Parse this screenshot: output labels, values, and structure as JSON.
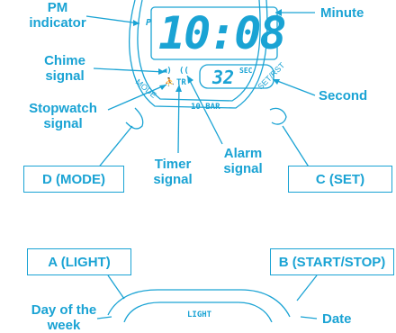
{
  "labels": {
    "pm_indicator": "PM\nindicator",
    "minute": "Minute",
    "chime_signal": "Chime\nsignal",
    "second": "Second",
    "stopwatch_signal": "Stopwatch\nsignal",
    "timer_signal": "Timer\nsignal",
    "alarm_signal": "Alarm\nsignal",
    "day_of_the_week": "Day of the\nweek",
    "date": "Date"
  },
  "buttons": {
    "d_mode": "D (MODE)",
    "c_set": "C (SET)",
    "a_light": "A (LIGHT)",
    "b_start_stop": "B (START/STOP)"
  },
  "watch": {
    "time_digits": "10:08",
    "pm_mark": "P",
    "second_digits": "32",
    "sec_label": "SEC",
    "tr_label": "TR",
    "mode_bezel": "MODE",
    "set_rst_bezel": "SET/RST",
    "water_resist": "10 BAR",
    "light_bezel": "LIGHT"
  },
  "colors": {
    "accent": "#1aa3d4",
    "background": "#ffffff"
  }
}
